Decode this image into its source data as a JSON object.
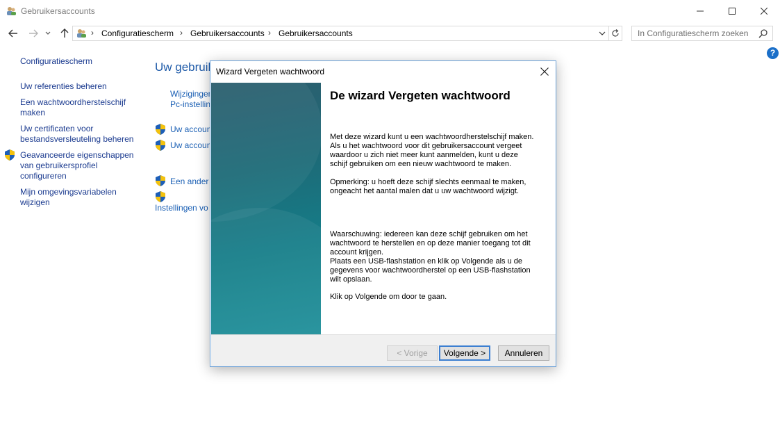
{
  "window": {
    "title": "Gebruikersaccounts"
  },
  "address": {
    "crumbs": [
      "Configuratiescherm",
      "Gebruikersaccounts",
      "Gebruikersaccounts"
    ],
    "search_placeholder": "In Configuratiescherm zoeken"
  },
  "leftnav": {
    "home": "Configuratiescherm",
    "links": [
      "Uw referenties beheren",
      "Een wachtwoordherstelschijf maken",
      "Uw certificaten voor bestandsversleuteling beheren",
      "Geavanceerde eigenschappen van gebruikersprofiel configureren",
      "Mijn omgevingsvariabelen wijzigen"
    ]
  },
  "main": {
    "title": "Uw gebruik",
    "links": [
      "Wijzigingen",
      "Pc-instellin",
      "Uw accoun",
      "Uw accoun",
      "Een ander a",
      "Instellingen vo"
    ]
  },
  "dialog": {
    "title": "Wizard Vergeten wachtwoord",
    "heading": "De wizard Vergeten wachtwoord",
    "para1": "Met deze wizard kunt u een wachtwoordherstelschijf maken.\nAls u het wachtwoord voor dit gebruikersaccount vergeet\nwaardoor u zich niet meer kunt aanmelden, kunt u deze\nschijf gebruiken om een nieuw wachtwoord te maken.",
    "para2": "Opmerking: u hoeft deze schijf slechts eenmaal te maken,\nongeacht het aantal malen dat u uw wachtwoord wijzigt.",
    "para3": "Waarschuwing: iedereen kan deze schijf gebruiken om het\nwachtwoord te herstellen en op deze manier toegang tot dit\naccount krijgen.\nPlaats een USB-flashstation en klik op Volgende als u de\ngegevens voor wachtwoordherstel op een USB-flashstation\nwilt opslaan.",
    "para4": "Klik op Volgende om door te gaan.",
    "buttons": {
      "back": "< Vorige",
      "next": "Volgende >",
      "cancel": "Annuleren"
    }
  },
  "icons": {
    "app": "users-icon",
    "help": "help-icon",
    "shield": "uac-shield-icon"
  },
  "colors": {
    "link": "#1a3a8f",
    "accent": "#1e5aa8",
    "dialog_side": "#1d6b78"
  }
}
